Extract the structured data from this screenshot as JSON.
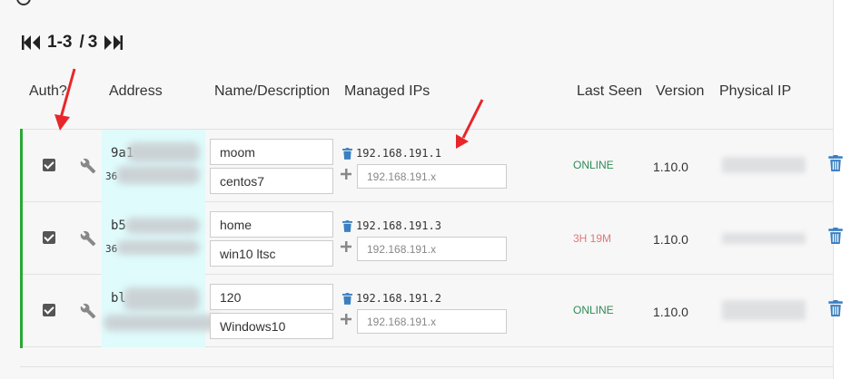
{
  "pager": {
    "range": "1-3",
    "separator": "/",
    "total": "3"
  },
  "columns": {
    "auth": "Auth?",
    "address": "Address",
    "name": "Name/Description",
    "managed_ips": "Managed IPs",
    "last_seen": "Last Seen",
    "version": "Version",
    "physical_ip": "Physical IP"
  },
  "rows": [
    {
      "address_id": "9a1",
      "address_sub": "36",
      "name": "moom",
      "description": "centos7",
      "ip": "192.168.191.1",
      "ip_placeholder": "192.168.191.x",
      "status": "ONLINE",
      "version": "1.10.0"
    },
    {
      "address_id": "b5",
      "address_sub": "36",
      "name": "home",
      "description": "win10 ltsc",
      "ip": "192.168.191.3",
      "ip_placeholder": "192.168.191.x",
      "status": "3H 19M",
      "version": "1.10.0"
    },
    {
      "address_id": "bl",
      "address_sub": "",
      "name": "120",
      "description": "Windows10",
      "ip": "192.168.191.2",
      "ip_placeholder": "192.168.191.x",
      "status": "ONLINE",
      "version": "1.10.0"
    }
  ],
  "colors": {
    "accent_green": "#2aa834",
    "online": "#2e8b57",
    "offline": "#e07878",
    "icon_blue": "#3a7fc1",
    "annotation": "#e8262a"
  },
  "icons": {
    "first_page": "double-chevron-left-icon",
    "last_page": "double-chevron-right-icon",
    "configure": "wrench-icon",
    "delete": "trash-icon",
    "add": "plus-icon"
  }
}
